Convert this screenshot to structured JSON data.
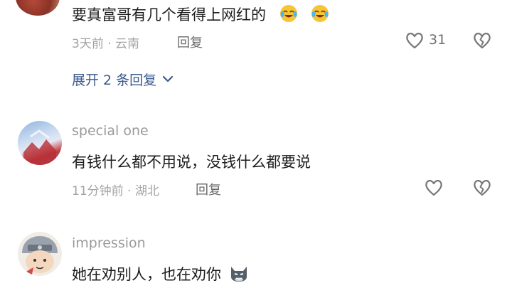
{
  "comments": [
    {
      "text": "要真富哥有几个看得上网红的",
      "emoji_names": [
        "laughing-crying-emoji",
        "laughing-crying-emoji"
      ],
      "meta": "3天前 · 云南",
      "reply_label": "回复",
      "like_count": "31",
      "expand_label": "展开 2 条回复"
    },
    {
      "username": "special one",
      "text": "有钱什么都不用说，没钱什么都要说",
      "meta": "11分钟前 · 湖北",
      "reply_label": "回复"
    },
    {
      "username": "impression",
      "text": "她在劝别人，也在劝你",
      "emoji_names": [
        "cat-face-emoji"
      ]
    }
  ],
  "icons": {
    "like": "heart-outline-icon",
    "dislike": "broken-heart-icon",
    "expand": "chevron-down-icon"
  },
  "colors": {
    "link": "#3a5a8c",
    "meta": "#a3a3a3",
    "text": "#1c1c1c",
    "icon": "#7a7a7a"
  }
}
